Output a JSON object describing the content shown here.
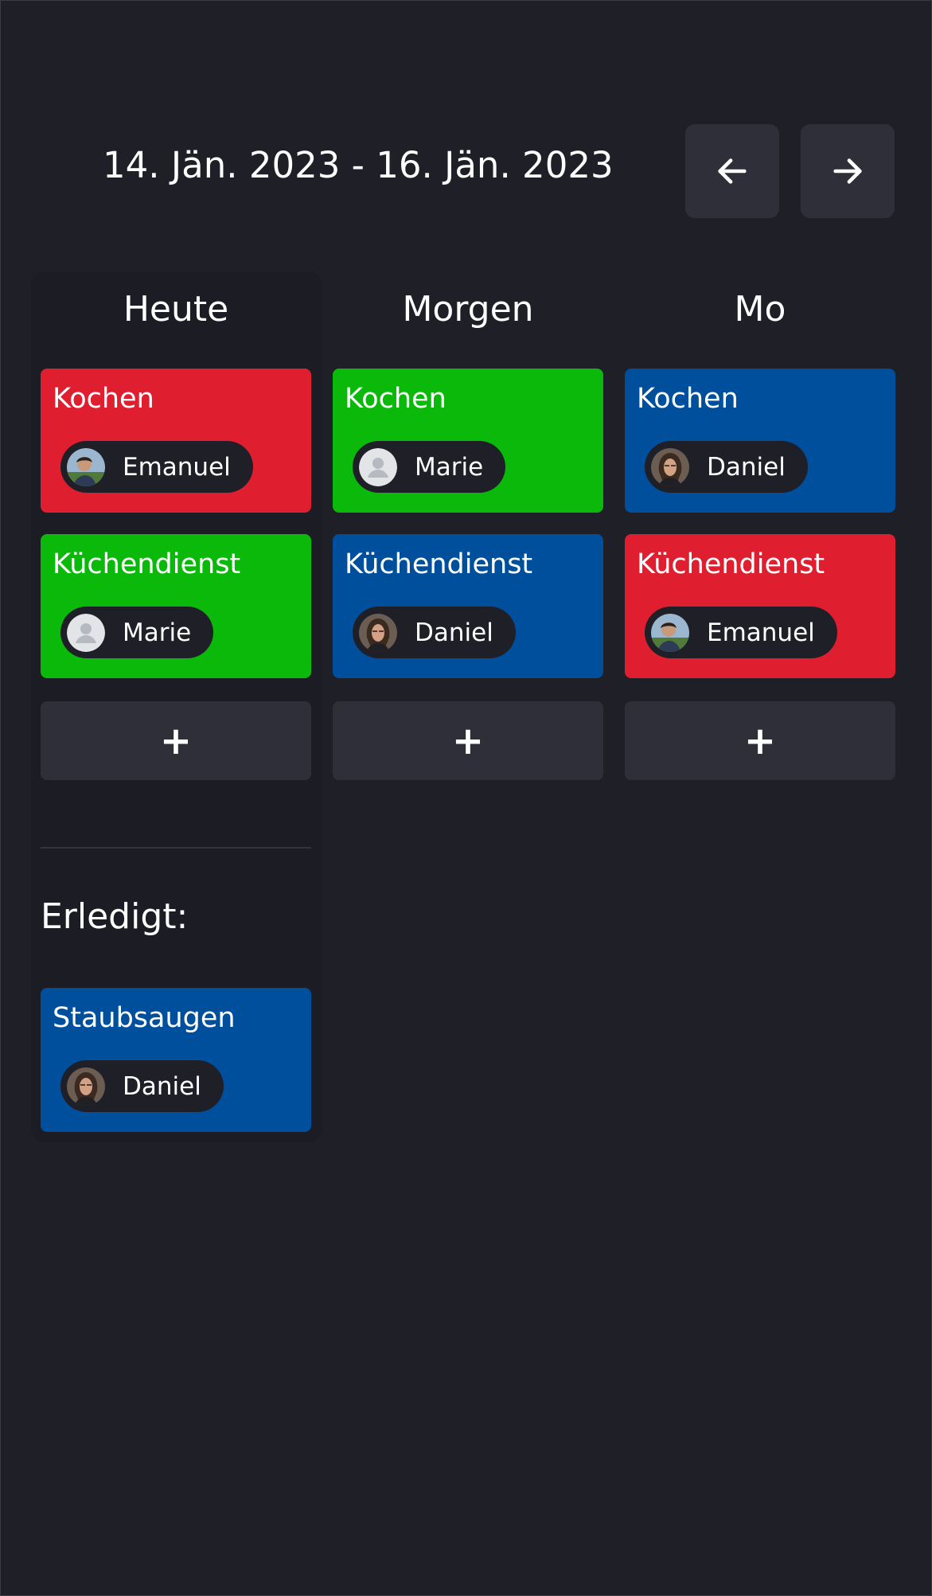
{
  "header": {
    "date_range": "14. Jän. 2023 - 16. Jän. 2023",
    "prev_icon": "arrow-left-icon",
    "next_icon": "arrow-right-icon"
  },
  "colors": {
    "background": "#1f1f28",
    "panel": "#1c1c24",
    "button": "#2e2f38",
    "red": "#df1f2f",
    "green": "#0bb90b",
    "blue": "#004f9c"
  },
  "columns": [
    {
      "title": "Heute",
      "tasks": [
        {
          "title": "Kochen",
          "color": "red",
          "person": "Emanuel",
          "avatar": "photo-avatar-emanuel"
        },
        {
          "title": "Küchendienst",
          "color": "green",
          "person": "Marie",
          "avatar": "default-user-icon"
        }
      ],
      "add_label": "+"
    },
    {
      "title": "Morgen",
      "tasks": [
        {
          "title": "Kochen",
          "color": "green",
          "person": "Marie",
          "avatar": "default-user-icon"
        },
        {
          "title": "Küchendienst",
          "color": "blue",
          "person": "Daniel",
          "avatar": "photo-avatar-daniel"
        }
      ],
      "add_label": "+"
    },
    {
      "title": "Mo",
      "tasks": [
        {
          "title": "Kochen",
          "color": "blue",
          "person": "Daniel",
          "avatar": "photo-avatar-daniel"
        },
        {
          "title": "Küchendienst",
          "color": "red",
          "person": "Emanuel",
          "avatar": "photo-avatar-emanuel"
        }
      ],
      "add_label": "+"
    }
  ],
  "done": {
    "label": "Erledigt:",
    "tasks": [
      {
        "title": "Staubsaugen",
        "color": "blue",
        "person": "Daniel",
        "avatar": "photo-avatar-daniel"
      }
    ]
  }
}
